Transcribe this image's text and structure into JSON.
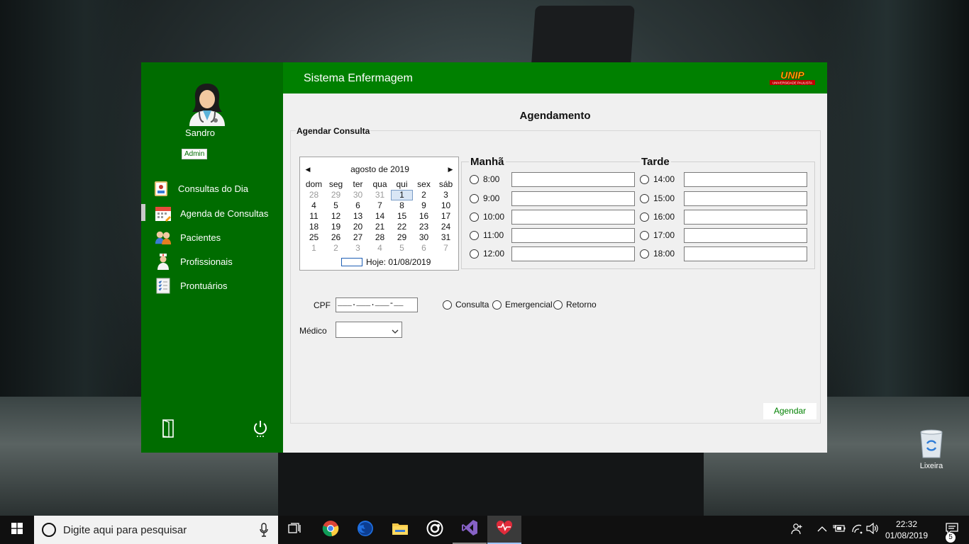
{
  "app": {
    "title": "Sistema Enfermagem",
    "logo_text": "UNIP",
    "logo_subtext": "UNIVERSIDADE PAULISTA",
    "accent_color": "#008000",
    "sidebar_color": "#006c00"
  },
  "user": {
    "name": "Sandro",
    "role": "Admin"
  },
  "sidebar": {
    "items": [
      {
        "label": "Consultas do Dia",
        "icon": "clipboard-user-icon"
      },
      {
        "label": "Agenda de Consultas",
        "icon": "calendar-icon"
      },
      {
        "label": "Pacientes",
        "icon": "patients-icon"
      },
      {
        "label": "Profissionais",
        "icon": "nurse-icon"
      },
      {
        "label": "Prontuários",
        "icon": "checklist-icon"
      }
    ],
    "active_index": 1,
    "bottom": {
      "logout_icon": "door-exit-icon",
      "power_icon": "power-icon"
    }
  },
  "page": {
    "title": "Agendamento",
    "group_label": "Agendar Consulta"
  },
  "calendar": {
    "month_label": "agosto de 2019",
    "weekdays": [
      "dom",
      "seg",
      "ter",
      "qua",
      "qui",
      "sex",
      "sáb"
    ],
    "days": [
      [
        "28",
        "29",
        "30",
        "31",
        "1",
        "2",
        "3"
      ],
      [
        "4",
        "5",
        "6",
        "7",
        "8",
        "9",
        "10"
      ],
      [
        "11",
        "12",
        "13",
        "14",
        "15",
        "16",
        "17"
      ],
      [
        "18",
        "19",
        "20",
        "21",
        "22",
        "23",
        "24"
      ],
      [
        "25",
        "26",
        "27",
        "28",
        "29",
        "30",
        "31"
      ],
      [
        "1",
        "2",
        "3",
        "4",
        "5",
        "6",
        "7"
      ]
    ],
    "selected_day": "1",
    "today_label": "Hoje: 01/08/2019"
  },
  "schedule": {
    "morning_label": "Manhã",
    "afternoon_label": "Tarde",
    "morning_times": [
      "8:00",
      "9:00",
      "10:00",
      "11:00",
      "12:00"
    ],
    "afternoon_times": [
      "14:00",
      "15:00",
      "16:00",
      "17:00",
      "18:00"
    ]
  },
  "form": {
    "cpf_label": "CPF",
    "cpf_mask": "___.___.___-__",
    "medico_label": "Médico",
    "medico_value": "",
    "types": [
      "Consulta",
      "Emergencial",
      "Retorno"
    ],
    "submit_label": "Agendar"
  },
  "desktop": {
    "recycle_bin_label": "Lixeira"
  },
  "taskbar": {
    "search_placeholder": "Digite aqui para pesquisar",
    "time": "22:32",
    "date": "01/08/2019",
    "notification_count": "5",
    "apps": [
      "task-view-icon",
      "chrome-icon",
      "firefox-icon",
      "file-explorer-icon",
      "obs-icon",
      "visual-studio-icon",
      "heartbeat-app-icon"
    ]
  }
}
